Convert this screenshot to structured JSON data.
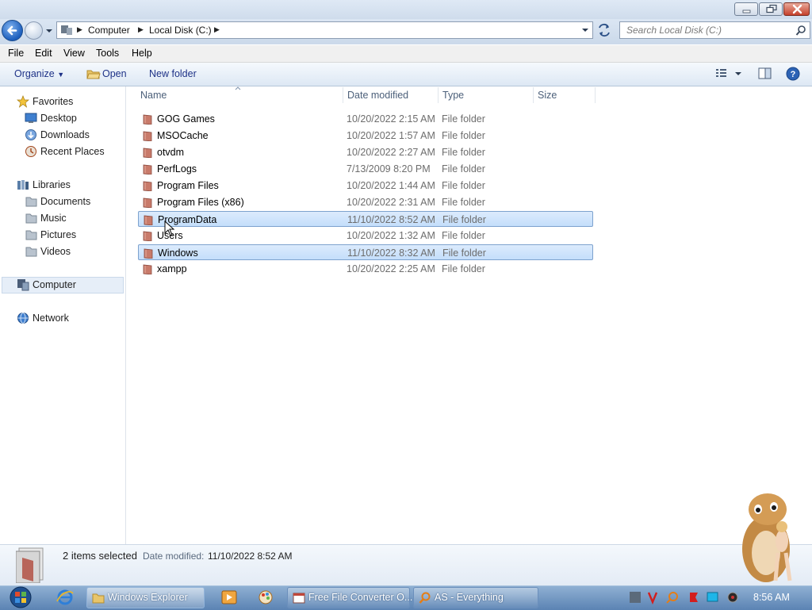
{
  "window": {
    "min_icon": "minimize-icon",
    "max_icon": "maximize-icon",
    "close_icon": "close-icon"
  },
  "address": {
    "breadcrumb": [
      "Computer",
      "Local Disk (C:)"
    ],
    "search_placeholder": "Search Local Disk (C:)"
  },
  "menu": [
    "File",
    "Edit",
    "View",
    "Tools",
    "Help"
  ],
  "commands": {
    "organize": "Organize",
    "open": "Open",
    "new_folder": "New folder"
  },
  "nav": {
    "favorites": "Favorites",
    "desktop": "Desktop",
    "downloads": "Downloads",
    "recent_places": "Recent Places",
    "libraries": "Libraries",
    "documents": "Documents",
    "music": "Music",
    "pictures": "Pictures",
    "videos": "Videos",
    "computer": "Computer",
    "network": "Network"
  },
  "columns": {
    "name": "Name",
    "date_modified": "Date modified",
    "type": "Type",
    "size": "Size"
  },
  "files": [
    {
      "name": "GOG Games",
      "date": "10/20/2022 2:15 AM",
      "type": "File folder",
      "selected": false
    },
    {
      "name": "MSOCache",
      "date": "10/20/2022 1:57 AM",
      "type": "File folder",
      "selected": false
    },
    {
      "name": "otvdm",
      "date": "10/20/2022 2:27 AM",
      "type": "File folder",
      "selected": false
    },
    {
      "name": "PerfLogs",
      "date": "7/13/2009 8:20 PM",
      "type": "File folder",
      "selected": false
    },
    {
      "name": "Program Files",
      "date": "10/20/2022 1:44 AM",
      "type": "File folder",
      "selected": false
    },
    {
      "name": "Program Files (x86)",
      "date": "10/20/2022 2:31 AM",
      "type": "File folder",
      "selected": false
    },
    {
      "name": "ProgramData",
      "date": "11/10/2022 8:52 AM",
      "type": "File folder",
      "selected": true
    },
    {
      "name": "Users",
      "date": "10/20/2022 1:32 AM",
      "type": "File folder",
      "selected": false
    },
    {
      "name": "Windows",
      "date": "11/10/2022 8:32 AM",
      "type": "File folder",
      "selected": true
    },
    {
      "name": "xampp",
      "date": "10/20/2022 2:25 AM",
      "type": "File folder",
      "selected": false
    }
  ],
  "details": {
    "selection_count": "2 items selected",
    "date_label": "Date modified:",
    "date_value": "11/10/2022 8:52 AM"
  },
  "taskbar": {
    "buttons": [
      {
        "label": "Windows Explorer",
        "active": true
      },
      {
        "label": "Free File Converter O...",
        "active": false
      },
      {
        "label": "AS - Everything",
        "active": false
      }
    ],
    "clock": "8:56 AM"
  },
  "colors": {
    "selection_fill": "#cce4fc",
    "selection_border": "#7da2ce",
    "link_blue": "#1e3287",
    "taskbar": "#6f93c0"
  }
}
